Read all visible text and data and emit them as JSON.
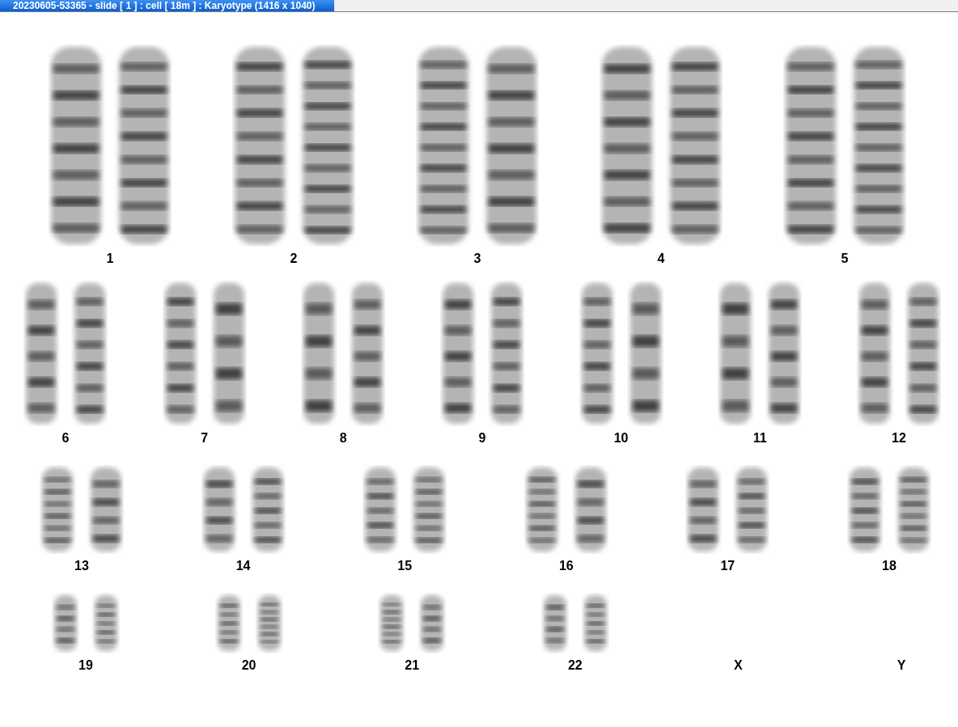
{
  "window": {
    "title": "20230605-53365 - slide [ 1 ] : cell [ 18m ] : Karyotype  (1416 x 1040)"
  },
  "karyotype": {
    "rows": [
      {
        "classes": [
          {
            "label": "1",
            "kind": "pair"
          },
          {
            "label": "2",
            "kind": "pair"
          },
          {
            "label": "3",
            "kind": "pair"
          },
          {
            "label": "4",
            "kind": "pair"
          },
          {
            "label": "5",
            "kind": "pair"
          }
        ]
      },
      {
        "classes": [
          {
            "label": "6",
            "kind": "pair"
          },
          {
            "label": "7",
            "kind": "pair"
          },
          {
            "label": "8",
            "kind": "pair"
          },
          {
            "label": "9",
            "kind": "pair"
          },
          {
            "label": "10",
            "kind": "pair"
          },
          {
            "label": "11",
            "kind": "pair"
          },
          {
            "label": "12",
            "kind": "pair"
          }
        ]
      },
      {
        "classes": [
          {
            "label": "13",
            "kind": "pair"
          },
          {
            "label": "14",
            "kind": "pair"
          },
          {
            "label": "15",
            "kind": "pair"
          },
          {
            "label": "16",
            "kind": "pair"
          },
          {
            "label": "17",
            "kind": "pair"
          },
          {
            "label": "18",
            "kind": "pair"
          }
        ]
      },
      {
        "classes": [
          {
            "label": "19",
            "kind": "pair"
          },
          {
            "label": "20",
            "kind": "pair"
          },
          {
            "label": "21",
            "kind": "pair"
          },
          {
            "label": "22",
            "kind": "pair"
          },
          {
            "label": "X",
            "kind": "empty"
          },
          {
            "label": "Y",
            "kind": "empty"
          }
        ]
      }
    ]
  }
}
